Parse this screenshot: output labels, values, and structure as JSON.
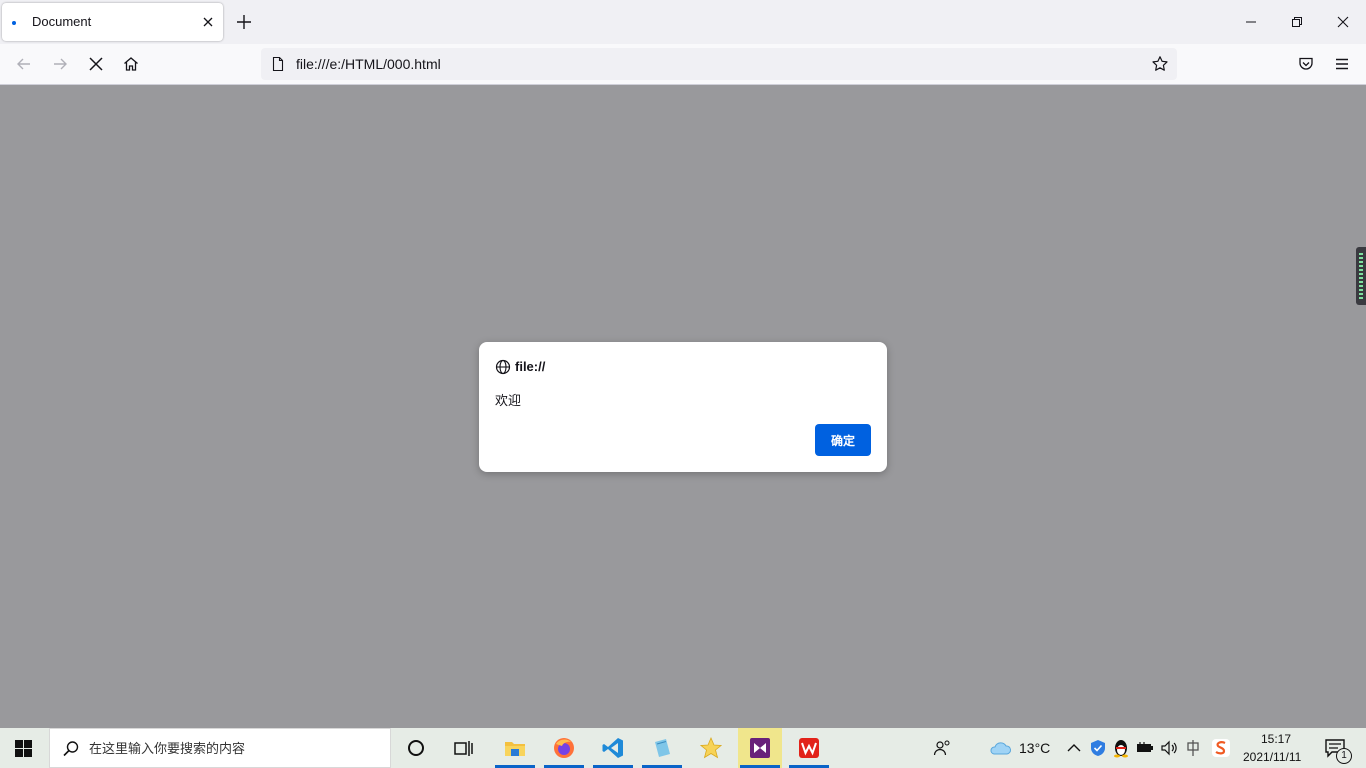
{
  "browser": {
    "tab": {
      "title": "Document"
    },
    "url": "file:///e:/HTML/000.html"
  },
  "dialog": {
    "origin": "file://",
    "message": "欢迎",
    "ok_label": "确定"
  },
  "taskbar": {
    "search_placeholder": "在这里输入你要搜索的内容",
    "weather_temp": "13°C",
    "time": "15:17",
    "date": "2021/11/11",
    "notification_count": "1"
  }
}
